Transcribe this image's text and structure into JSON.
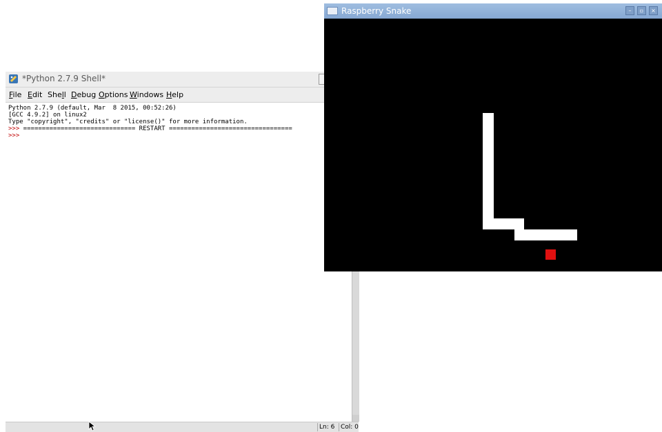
{
  "shell": {
    "title": "*Python 2.7.9 Shell*",
    "menu": [
      {
        "accel": "F",
        "rest": "ile"
      },
      {
        "accel": "E",
        "rest": "dit"
      },
      {
        "pre": "She",
        "accel": "l",
        "rest": "l"
      },
      {
        "accel": "D",
        "rest": "ebug"
      },
      {
        "accel": "O",
        "rest": "ptions"
      },
      {
        "accel": "W",
        "rest": "indows"
      },
      {
        "accel": "H",
        "rest": "elp"
      }
    ],
    "lines": [
      "Python 2.7.9 (default, Mar  8 2015, 00:52:26)",
      "[GCC 4.9.2] on linux2",
      "Type \"copyright\", \"credits\" or \"license()\" for more information."
    ],
    "restart_prompt": ">>>",
    "restart_text": " ============================== RESTART =================================",
    "prompt": ">>>",
    "status": {
      "line": "Ln: 6",
      "col": "Col: 0"
    }
  },
  "game": {
    "title": "Raspberry Snake",
    "buttons": {
      "minimize": "–",
      "maximize": "▫",
      "close": "×"
    },
    "colors": {
      "background": "#000000",
      "snake": "#ffffff",
      "food": "#e01010"
    }
  }
}
